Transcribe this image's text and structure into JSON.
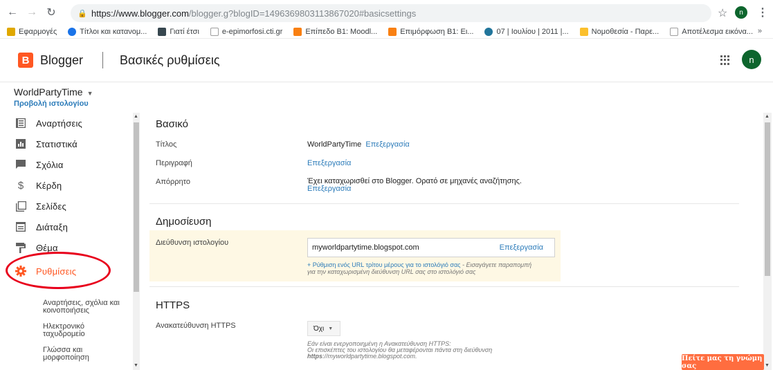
{
  "browser": {
    "url_host": "https://www.blogger.com",
    "url_path": "/blogger.g?blogID=1496369803113867020#basicsettings",
    "profile_initial": "n"
  },
  "bookmarks": [
    {
      "label": "Εφαρμογές",
      "icon": "apps-icon",
      "color": "#e0a800"
    },
    {
      "label": "Τίτλοι και κατανομ...",
      "icon": "site-icon",
      "color": "#1a73e8"
    },
    {
      "label": "Γιατί έτσι",
      "icon": "site-icon",
      "color": "#37474f"
    },
    {
      "label": "e-epimorfosi.cti.gr",
      "icon": "page-icon",
      "color": "#9e9e9e"
    },
    {
      "label": "Επίπεδο Β1: Moodl...",
      "icon": "moodle-icon",
      "color": "#f98012"
    },
    {
      "label": "Επιμόρφωση Β1: Ει...",
      "icon": "moodle-icon",
      "color": "#f98012"
    },
    {
      "label": "07 | Ιουλίου | 2011 |...",
      "icon": "wordpress-icon",
      "color": "#21759b"
    },
    {
      "label": "Νομοθεσία - Παρε...",
      "icon": "site-icon",
      "color": "#fbc02d"
    },
    {
      "label": "Αποτέλεσμα εικόνα...",
      "icon": "page-icon",
      "color": "#9e9e9e"
    }
  ],
  "header": {
    "brand": "Blogger",
    "title": "Βασικές ρυθμίσεις",
    "avatar": "n",
    "accent": "#ff5722"
  },
  "blog": {
    "name": "WorldPartyTime",
    "view_link": "Προβολή ιστολογίου"
  },
  "sidebar": {
    "items": [
      {
        "label": "Αναρτήσεις",
        "icon": "posts-icon"
      },
      {
        "label": "Στατιστικά",
        "icon": "stats-icon"
      },
      {
        "label": "Σχόλια",
        "icon": "comments-icon"
      },
      {
        "label": "Κέρδη",
        "icon": "earnings-icon"
      },
      {
        "label": "Σελίδες",
        "icon": "pages-icon"
      },
      {
        "label": "Διάταξη",
        "icon": "layout-icon"
      },
      {
        "label": "Θέμα",
        "icon": "theme-icon"
      },
      {
        "label": "Ρυθμίσεις",
        "icon": "settings-icon"
      }
    ],
    "subitems": [
      {
        "label": "Αναρτήσεις, σχόλια και κοινοποιήσεις"
      },
      {
        "label": "Ηλεκτρονικό ταχυδρομείο"
      },
      {
        "label": "Γλώσσα και μορφοποίηση"
      }
    ]
  },
  "basic": {
    "title": "Βασικό",
    "rows": [
      {
        "label": "Τίτλος",
        "value": "WorldPartyTime",
        "link": "Επεξεργασία"
      },
      {
        "label": "Περιγραφή",
        "value": "",
        "link": "Επεξεργασία"
      },
      {
        "label": "Απόρρητο",
        "value": "Έχει καταχωρισθεί στο Blogger. Ορατό σε μηχανές αναζήτησης.",
        "link": "Επεξεργασία"
      }
    ]
  },
  "publishing": {
    "title": "Δημοσίευση",
    "address_label": "Διεύθυνση ιστολογίου",
    "address_value": "myworldpartytime.blogspot.com",
    "address_edit": "Επεξεργασία",
    "third_party_link": "+ Ρύθμιση ενός URL τρίτου μέρους για το ιστολόγιό σας",
    "third_party_note_1": " - Εισαγάγετε παραπομπή",
    "third_party_note_2": "για την καταχωρισμένη διεύθυνση URL σας στο ιστολόγιό σας"
  },
  "https": {
    "title": "HTTPS",
    "redirect_label": "Ανακατεύθυνση HTTPS",
    "redirect_value": "Όχι",
    "note_1": "Εάν είναι ενεργοποιημένη η Ανακατεύθυνση HTTPS:",
    "note_2": "Οι επισκέπτες του ιστολογίου θα μεταφέρονται πάντα στη διεύθυνση",
    "note_3_bold": "https",
    "note_3_rest": "://myworldpartytime.blogspot.com."
  },
  "feedback": {
    "label": "Πείτε μας τη γνώμη σας"
  }
}
